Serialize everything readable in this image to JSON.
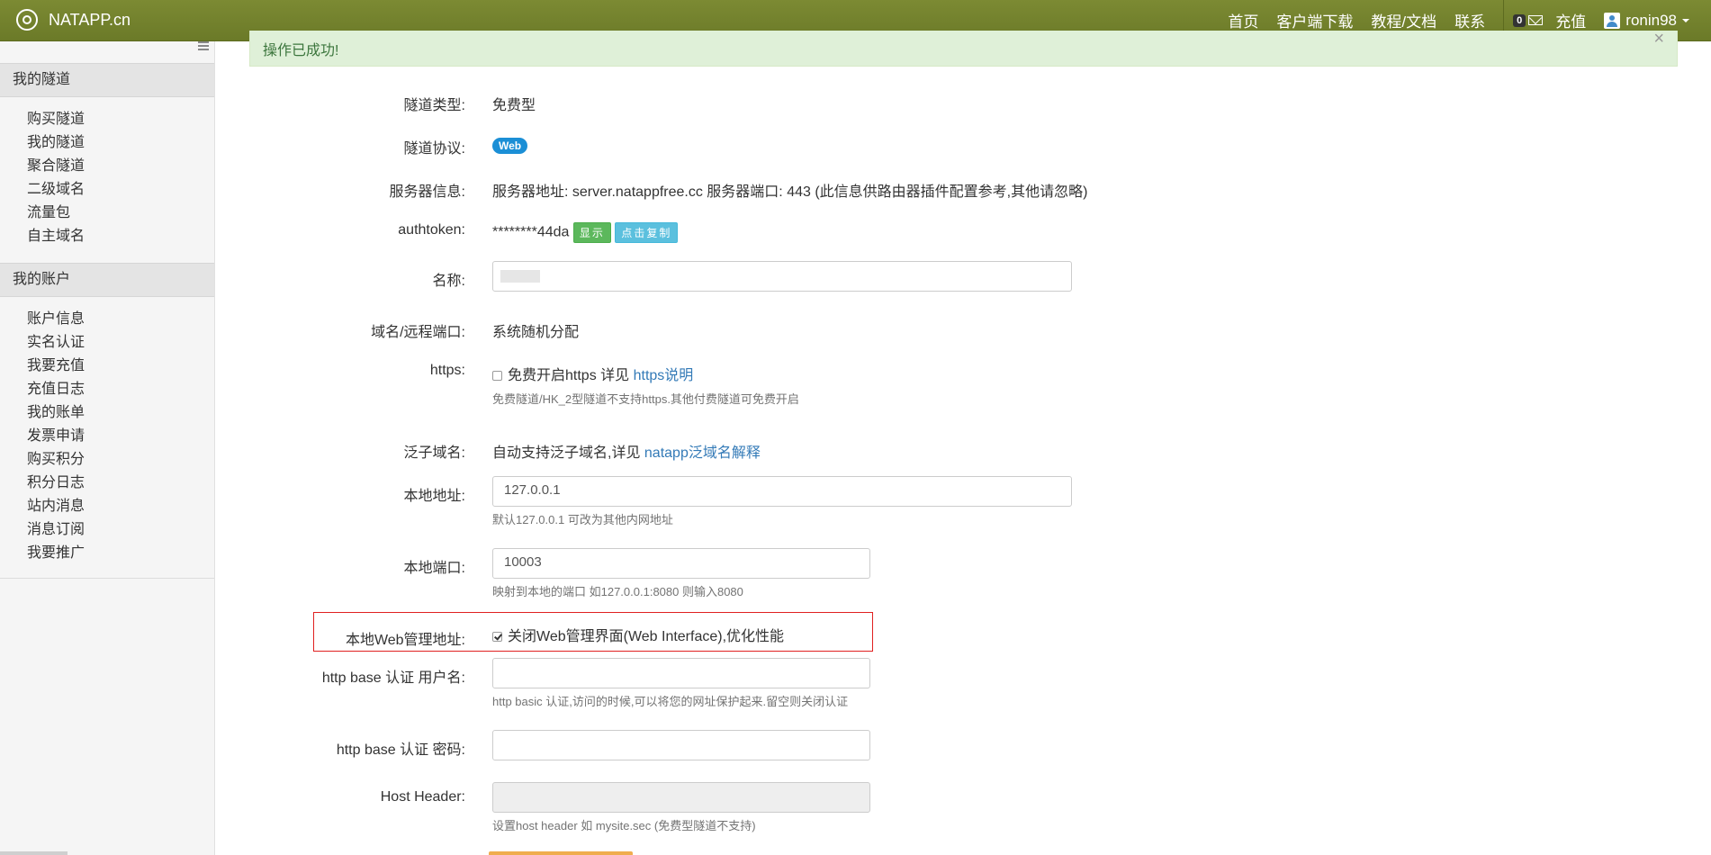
{
  "navbar": {
    "brand": "NATAPP.cn",
    "links": [
      "首页",
      "客户端下载",
      "教程/文档",
      "联系"
    ],
    "message_count": "0",
    "recharge": "充值",
    "username": "ronin98"
  },
  "sidebar": {
    "sections": [
      {
        "title": "我的隧道",
        "items": [
          "购买隧道",
          "我的隧道",
          "聚合隧道",
          "二级域名",
          "流量包",
          "自主域名"
        ]
      },
      {
        "title": "我的账户",
        "items": [
          "账户信息",
          "实名认证",
          "我要充值",
          "充值日志",
          "我的账单",
          "发票申请",
          "购买积分",
          "积分日志",
          "站内消息",
          "消息订阅",
          "我要推广"
        ]
      }
    ]
  },
  "alert": {
    "text": "操作已成功!",
    "close": "×"
  },
  "form": {
    "tunnel_type": {
      "label": "隧道类型:",
      "value": "免费型"
    },
    "protocol": {
      "label": "隧道协议:",
      "badge": "Web"
    },
    "server": {
      "label": "服务器信息:",
      "value": "服务器地址: server.natappfree.cc 服务器端口: 443 (此信息供路由器插件配置参考,其他请忽略)"
    },
    "authtoken": {
      "label": "authtoken:",
      "value": "********44da",
      "show_button": "显示",
      "copy_button": "点击复制"
    },
    "name": {
      "label": "名称:",
      "value": ""
    },
    "domain": {
      "label": "域名/远程端口:",
      "value": "系统随机分配"
    },
    "https": {
      "label": "https:",
      "checkbox_text": "免费开启https 详见",
      "link": "https说明",
      "checked": false,
      "help": "免费隧道/HK_2型隧道不支持https.其他付费隧道可免费开启"
    },
    "wildcard": {
      "label": "泛子域名:",
      "value": "自动支持泛子域名,详见",
      "link": "natapp泛域名解释"
    },
    "local_addr": {
      "label": "本地地址:",
      "value": "127.0.0.1",
      "help": "默认127.0.0.1 可改为其他内网地址"
    },
    "local_port": {
      "label": "本地端口:",
      "value": "10003",
      "help": "映射到本地的端口 如127.0.0.1:8080 则输入8080"
    },
    "web_admin": {
      "label": "本地Web管理地址:",
      "checkbox_text": "关闭Web管理界面(Web Interface),优化性能",
      "checked": true
    },
    "basic_user": {
      "label": "http base 认证 用户名:",
      "value": "",
      "help": "http basic 认证,访问的时候,可以将您的网址保护起来.留空则关闭认证"
    },
    "basic_pass": {
      "label": "http base 认证 密码:",
      "value": ""
    },
    "host_header": {
      "label": "Host Header:",
      "value": "",
      "help": "设置host header 如 mysite.sec (免费型隧道不支持)"
    }
  }
}
